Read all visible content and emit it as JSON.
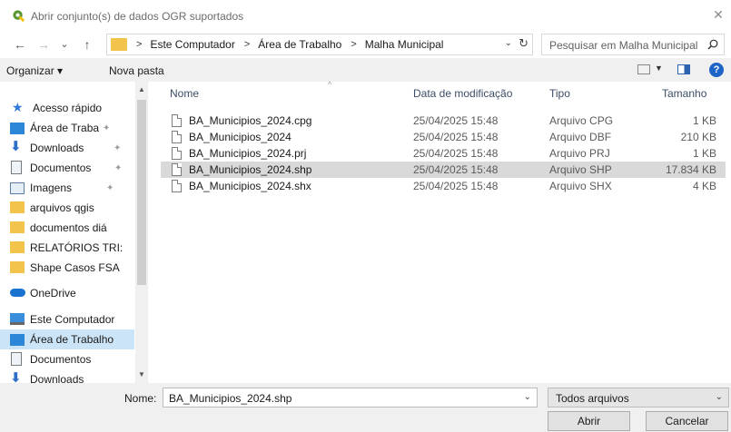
{
  "window": {
    "title": "Abrir conjunto(s) de dados OGR suportados",
    "close": "✕"
  },
  "nav": {
    "back": "←",
    "forward": "→",
    "recent": "⌄",
    "up": "↑",
    "breadcrumbs": [
      "Este Computador",
      "Área de Trabalho",
      "Malha Municipal"
    ],
    "search_placeholder": "Pesquisar em Malha Municipal"
  },
  "toolbar": {
    "organize": "Organizar ▾",
    "new_folder": "Nova pasta"
  },
  "sidebar": {
    "items": [
      {
        "label": "Acesso rápido",
        "icon": "star-icon",
        "pinned": false
      },
      {
        "label": "Área de Traba",
        "icon": "desktop-icon",
        "pinned": true
      },
      {
        "label": "Downloads",
        "icon": "download-icon",
        "pinned": true
      },
      {
        "label": "Documentos",
        "icon": "document-icon",
        "pinned": true
      },
      {
        "label": "Imagens",
        "icon": "image-icon",
        "pinned": true
      },
      {
        "label": "arquivos qgis",
        "icon": "folder-icon",
        "pinned": false
      },
      {
        "label": "documentos diá",
        "icon": "folder-icon",
        "pinned": false
      },
      {
        "label": "RELATÓRIOS TRI:",
        "icon": "folder-icon",
        "pinned": false
      },
      {
        "label": "Shape Casos FSA",
        "icon": "folder-icon",
        "pinned": false
      },
      {
        "label": "OneDrive",
        "icon": "cloud-icon",
        "pinned": false
      },
      {
        "label": "Este Computador",
        "icon": "computer-icon",
        "pinned": false
      },
      {
        "label": "Área de Trabalho",
        "icon": "desktop-icon",
        "pinned": false
      },
      {
        "label": "Documentos",
        "icon": "document-icon",
        "pinned": false
      },
      {
        "label": "Downloads",
        "icon": "download-icon",
        "pinned": false
      }
    ],
    "pin_glyph": "📌"
  },
  "columns": {
    "name": "Nome",
    "date": "Data de modificação",
    "type": "Tipo",
    "size": "Tamanho"
  },
  "files": [
    {
      "name": "BA_Municipios_2024.cpg",
      "date": "25/04/2025 15:48",
      "type": "Arquivo CPG",
      "size": "1 KB"
    },
    {
      "name": "BA_Municipios_2024",
      "date": "25/04/2025 15:48",
      "type": "Arquivo DBF",
      "size": "210 KB"
    },
    {
      "name": "BA_Municipios_2024.prj",
      "date": "25/04/2025 15:48",
      "type": "Arquivo PRJ",
      "size": "1 KB"
    },
    {
      "name": "BA_Municipios_2024.shp",
      "date": "25/04/2025 15:48",
      "type": "Arquivo SHP",
      "size": "17.834 KB"
    },
    {
      "name": "BA_Municipios_2024.shx",
      "date": "25/04/2025 15:48",
      "type": "Arquivo SHX",
      "size": "4 KB"
    }
  ],
  "footer": {
    "name_label": "Nome:",
    "name_value": "BA_Municipios_2024.shp",
    "filter_value": "Todos arquivos",
    "open_label": "Abrir",
    "cancel_label": "Cancelar"
  },
  "colors": {
    "accent": "#1e63c6",
    "selection": "#d9d9d9",
    "folder": "#f3c44b",
    "qgis_green": "#589632"
  }
}
